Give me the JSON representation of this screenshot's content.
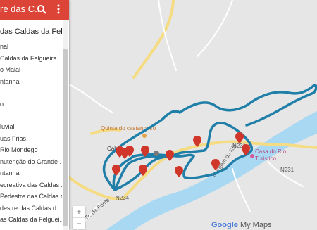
{
  "sidebar": {
    "title": "re das C...",
    "layer_title": "das Caldas da Felgue...",
    "items": [
      "nal",
      "Caldas da Felgueira",
      "o Maial",
      "ntanha",
      "o",
      "luvial",
      "uas Frias",
      "Rio Mondego",
      "nutenção do Grande ...",
      "ntanha",
      "ecreativa das Caldas ...",
      "Pedestre das Caldas d...",
      "destre das Caldas d...",
      "as Caldas da Felguei..."
    ]
  },
  "map": {
    "place_quinta": "Quinta do castanheiro",
    "place_casa": "Casa do Rio",
    "place_casa2": "Turistico",
    "place_caldas": "Calda",
    "road_n231": "N231",
    "road_n234": "N234",
    "road_n231_1": "N231-1",
    "road_fonte": "R. da Fonte",
    "road_margem": "Margem do Rio",
    "credit_google": "Google",
    "credit_mymaps": "My Maps"
  },
  "zoom": {
    "in": "+",
    "out": "−"
  },
  "colors": {
    "header": "#db4437",
    "route": "#1f7fa8",
    "river": "#a9d8f3",
    "road": "#f7e08a",
    "marker": "#d1362b"
  }
}
